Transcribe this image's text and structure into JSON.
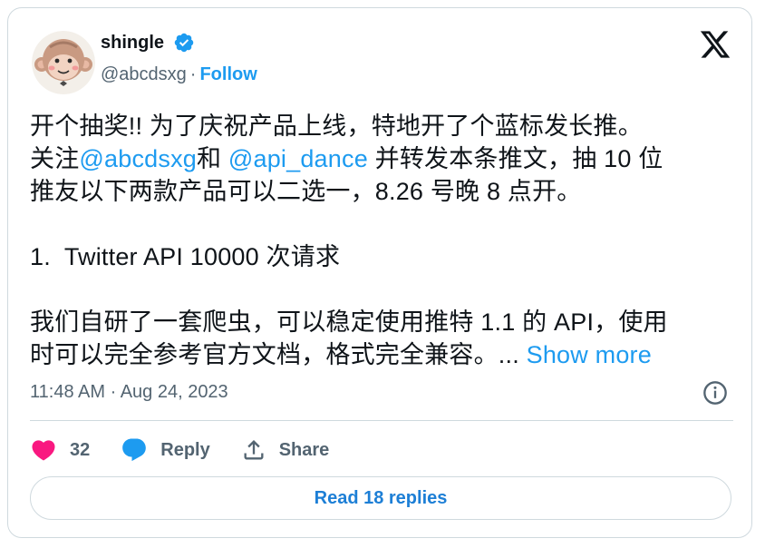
{
  "author": {
    "name": "shingle",
    "handle": "@abcdsxg",
    "separator": "·",
    "follow_label": "Follow",
    "verified_color": "#1d9bf0",
    "avatar_icon": "monkey-avatar"
  },
  "tweet": {
    "line1": "开个抽奖!! 为了庆祝产品上线，特地开了个蓝标发长推。",
    "line2_prefix": "关注",
    "mention1": "@abcdsxg",
    "line2_mid": "和 ",
    "mention2": "@api_dance",
    "line2_suffix": " 并转发本条推文，抽 10 位",
    "line3": "推友以下两款产品可以二选一，8.26 号晚 8 点开。",
    "line4": "1.  Twitter API 10000 次请求",
    "line5": "我们自研了一套爬虫，可以稳定使用推特 1.1 的 API，使用",
    "line6": "时可以完全参考官方文档，格式完全兼容。... ",
    "show_more": "Show more"
  },
  "timestamp": "11:48 AM · Aug 24, 2023",
  "actions": {
    "like_count": "32",
    "reply_label": "Reply",
    "share_label": "Share"
  },
  "read_replies_label": "Read 18 replies",
  "colors": {
    "accent": "#1d9bf0",
    "like": "#f91880",
    "secondary_text": "#536471",
    "border": "#cfd9de"
  }
}
